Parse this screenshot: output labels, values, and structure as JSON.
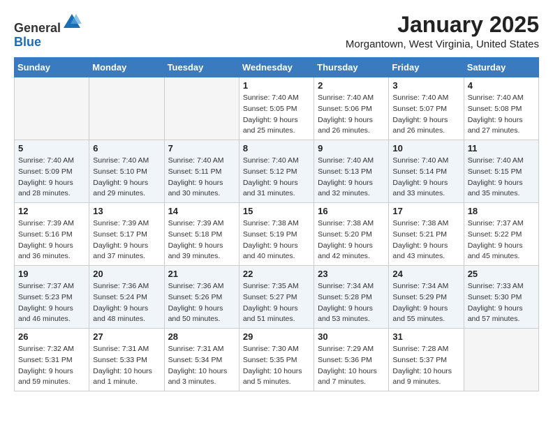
{
  "header": {
    "logo_line1": "General",
    "logo_line2": "Blue",
    "month": "January 2025",
    "location": "Morgantown, West Virginia, United States"
  },
  "weekdays": [
    "Sunday",
    "Monday",
    "Tuesday",
    "Wednesday",
    "Thursday",
    "Friday",
    "Saturday"
  ],
  "weeks": [
    [
      {
        "day": "",
        "info": ""
      },
      {
        "day": "",
        "info": ""
      },
      {
        "day": "",
        "info": ""
      },
      {
        "day": "1",
        "info": "Sunrise: 7:40 AM\nSunset: 5:05 PM\nDaylight: 9 hours\nand 25 minutes."
      },
      {
        "day": "2",
        "info": "Sunrise: 7:40 AM\nSunset: 5:06 PM\nDaylight: 9 hours\nand 26 minutes."
      },
      {
        "day": "3",
        "info": "Sunrise: 7:40 AM\nSunset: 5:07 PM\nDaylight: 9 hours\nand 26 minutes."
      },
      {
        "day": "4",
        "info": "Sunrise: 7:40 AM\nSunset: 5:08 PM\nDaylight: 9 hours\nand 27 minutes."
      }
    ],
    [
      {
        "day": "5",
        "info": "Sunrise: 7:40 AM\nSunset: 5:09 PM\nDaylight: 9 hours\nand 28 minutes."
      },
      {
        "day": "6",
        "info": "Sunrise: 7:40 AM\nSunset: 5:10 PM\nDaylight: 9 hours\nand 29 minutes."
      },
      {
        "day": "7",
        "info": "Sunrise: 7:40 AM\nSunset: 5:11 PM\nDaylight: 9 hours\nand 30 minutes."
      },
      {
        "day": "8",
        "info": "Sunrise: 7:40 AM\nSunset: 5:12 PM\nDaylight: 9 hours\nand 31 minutes."
      },
      {
        "day": "9",
        "info": "Sunrise: 7:40 AM\nSunset: 5:13 PM\nDaylight: 9 hours\nand 32 minutes."
      },
      {
        "day": "10",
        "info": "Sunrise: 7:40 AM\nSunset: 5:14 PM\nDaylight: 9 hours\nand 33 minutes."
      },
      {
        "day": "11",
        "info": "Sunrise: 7:40 AM\nSunset: 5:15 PM\nDaylight: 9 hours\nand 35 minutes."
      }
    ],
    [
      {
        "day": "12",
        "info": "Sunrise: 7:39 AM\nSunset: 5:16 PM\nDaylight: 9 hours\nand 36 minutes."
      },
      {
        "day": "13",
        "info": "Sunrise: 7:39 AM\nSunset: 5:17 PM\nDaylight: 9 hours\nand 37 minutes."
      },
      {
        "day": "14",
        "info": "Sunrise: 7:39 AM\nSunset: 5:18 PM\nDaylight: 9 hours\nand 39 minutes."
      },
      {
        "day": "15",
        "info": "Sunrise: 7:38 AM\nSunset: 5:19 PM\nDaylight: 9 hours\nand 40 minutes."
      },
      {
        "day": "16",
        "info": "Sunrise: 7:38 AM\nSunset: 5:20 PM\nDaylight: 9 hours\nand 42 minutes."
      },
      {
        "day": "17",
        "info": "Sunrise: 7:38 AM\nSunset: 5:21 PM\nDaylight: 9 hours\nand 43 minutes."
      },
      {
        "day": "18",
        "info": "Sunrise: 7:37 AM\nSunset: 5:22 PM\nDaylight: 9 hours\nand 45 minutes."
      }
    ],
    [
      {
        "day": "19",
        "info": "Sunrise: 7:37 AM\nSunset: 5:23 PM\nDaylight: 9 hours\nand 46 minutes."
      },
      {
        "day": "20",
        "info": "Sunrise: 7:36 AM\nSunset: 5:24 PM\nDaylight: 9 hours\nand 48 minutes."
      },
      {
        "day": "21",
        "info": "Sunrise: 7:36 AM\nSunset: 5:26 PM\nDaylight: 9 hours\nand 50 minutes."
      },
      {
        "day": "22",
        "info": "Sunrise: 7:35 AM\nSunset: 5:27 PM\nDaylight: 9 hours\nand 51 minutes."
      },
      {
        "day": "23",
        "info": "Sunrise: 7:34 AM\nSunset: 5:28 PM\nDaylight: 9 hours\nand 53 minutes."
      },
      {
        "day": "24",
        "info": "Sunrise: 7:34 AM\nSunset: 5:29 PM\nDaylight: 9 hours\nand 55 minutes."
      },
      {
        "day": "25",
        "info": "Sunrise: 7:33 AM\nSunset: 5:30 PM\nDaylight: 9 hours\nand 57 minutes."
      }
    ],
    [
      {
        "day": "26",
        "info": "Sunrise: 7:32 AM\nSunset: 5:31 PM\nDaylight: 9 hours\nand 59 minutes."
      },
      {
        "day": "27",
        "info": "Sunrise: 7:31 AM\nSunset: 5:33 PM\nDaylight: 10 hours\nand 1 minute."
      },
      {
        "day": "28",
        "info": "Sunrise: 7:31 AM\nSunset: 5:34 PM\nDaylight: 10 hours\nand 3 minutes."
      },
      {
        "day": "29",
        "info": "Sunrise: 7:30 AM\nSunset: 5:35 PM\nDaylight: 10 hours\nand 5 minutes."
      },
      {
        "day": "30",
        "info": "Sunrise: 7:29 AM\nSunset: 5:36 PM\nDaylight: 10 hours\nand 7 minutes."
      },
      {
        "day": "31",
        "info": "Sunrise: 7:28 AM\nSunset: 5:37 PM\nDaylight: 10 hours\nand 9 minutes."
      },
      {
        "day": "",
        "info": ""
      }
    ]
  ]
}
